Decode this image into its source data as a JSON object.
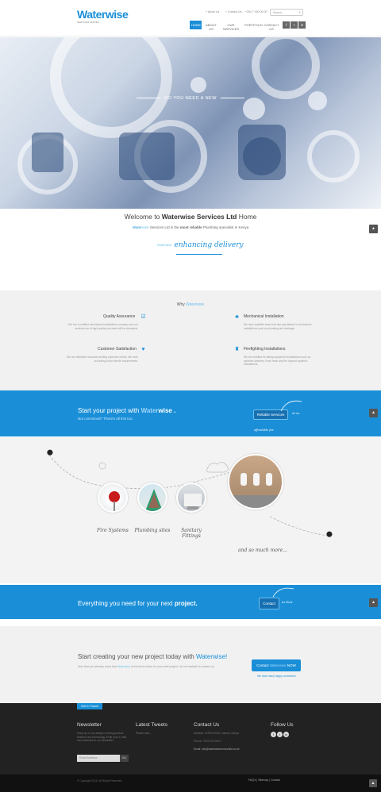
{
  "header": {
    "logo_main": "Waterwise",
    "logo_sub": "SERVICES LIMITED",
    "top_links": [
      "+ About Us",
      "+ Contact Us",
      "+254 7 000 00 00"
    ],
    "search_placeholder": "Search...",
    "nav": [
      "HOME",
      "ABOUT US",
      "OUR SERVICES",
      "PORTFOLIO",
      "CONTACT US"
    ],
    "social": [
      "f",
      "t",
      "in"
    ]
  },
  "hero": {
    "caption": "DO YOU NEED A NEW"
  },
  "welcome": {
    "title_pre": "Welcome to ",
    "title_brand_a": "Water",
    "title_brand_b": "wise",
    "title_bold": " Services Ltd",
    "title_post": " Home",
    "sub_brand_a": "Water",
    "sub_brand_b": "wise",
    "sub_mid": " Services Ltd is the ",
    "sub_bold": "most reliable",
    "sub_post": " Plumbing specialist in Kenya",
    "tagline_small": "Waterwise",
    "tagline": "enhancing delivery"
  },
  "why": {
    "title_pre": "Why ",
    "title_brand": "Waterwise",
    "features": [
      {
        "title": "Quality Assurance",
        "text": "We are a certified mechanical installations company and our services are of high quality and meet all the standards.",
        "icon": "check-icon"
      },
      {
        "title": "Mechanical Installation",
        "text": "We have qualified team that has specialised in mechanical installations such as plumbing and drainage.",
        "icon": "plumbing-icon"
      },
      {
        "title": "Customer Satisfaction",
        "text": "We are dedicated towards meeting customer needs. We work according to the client's requirements.",
        "icon": "heart-icon"
      },
      {
        "title": "Firefighting Installations",
        "text": "We are certified for taking equipment installations such as sprinkler systems, Hose reels and fire hydrant systemic installations.",
        "icon": "extinguisher-icon"
      }
    ]
  },
  "band1": {
    "title_pre": "Start your project with ",
    "title_brand_a": "Water",
    "title_brand_b": "wise",
    "title_post": " .",
    "sub": "Not convinced? There's all this too.",
    "button": "Reliable Services",
    "hand_right": "at an",
    "hand_below": "affordable fee"
  },
  "gallery": {
    "items": [
      "Fire Systems",
      "Plumbing sites",
      "Sanitary Fittings"
    ],
    "more": "and so much more..."
  },
  "band2": {
    "title_pre": "Everything you need for your next ",
    "title_bold": "project.",
    "button": "Contact",
    "hand": "us Now"
  },
  "cta": {
    "title_pre": "Start creating your new project today with ",
    "title_brand": "Waterwise!",
    "text_pre": "Now that you already know that ",
    "text_brand": "Waterwise",
    "text_post": " is the best choice for your next project, do not hesitate to contact us.",
    "button_pre": "Contact ",
    "button_brand": "Waterwise",
    "button_post": " NOW",
    "note": "We have many happy customers!"
  },
  "footer": {
    "tab": "Get in Touch",
    "newsletter_h": "Newsletter",
    "newsletter_p": "Keep up on our always evolving product features and technology. Enter your e-mail and subscribe to our newsletter.",
    "newsletter_placeholder": "Email Address",
    "newsletter_btn": "Go!",
    "tweets_h": "Latest Tweets",
    "tweets_p": "Please wait...",
    "contact_h": "Contact Us",
    "address": "Address: 10759-00100, Nairobi, Kenya",
    "phone": "Phone: +254 700 000 0",
    "email": "Email: info@waterwiseservicesltd.co.ke",
    "follow_h": "Follow Us",
    "social": [
      "f",
      "t",
      "in"
    ],
    "copyright": "© Copyright 2016. All Rights Reserved.",
    "bottom_links": "FAQ's  |  Sitemap  |  Contact"
  },
  "colors": {
    "accent": "#1a8fd8",
    "light_accent": "#6ec0ef",
    "footer": "#222222"
  }
}
